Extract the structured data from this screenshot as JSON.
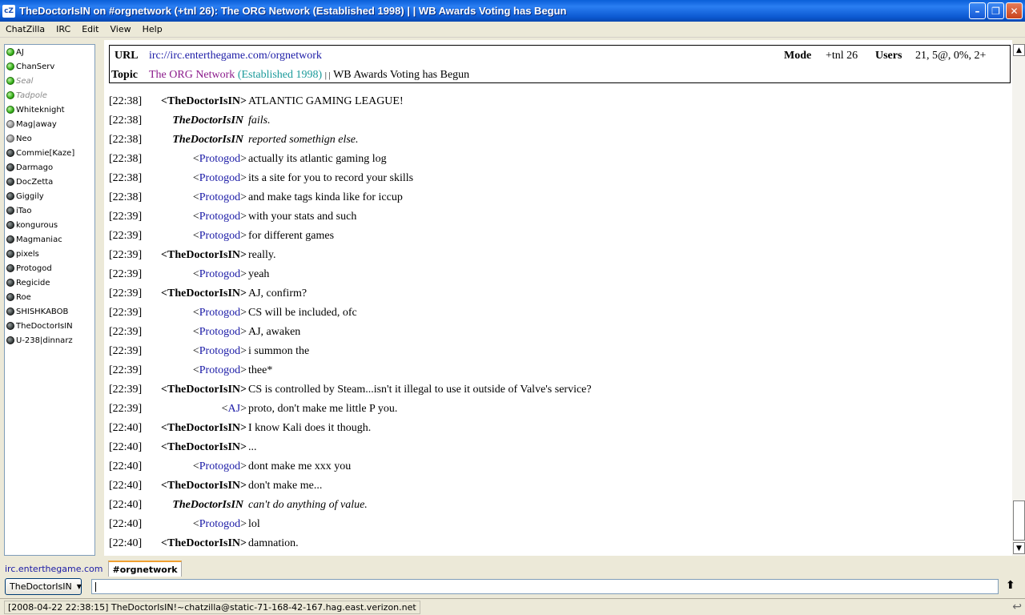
{
  "window": {
    "title": "TheDoctorIsIN on #orgnetwork (+tnl 26): The ORG Network (Established 1998) | | WB Awards Voting has Begun",
    "icon_label": "cZ",
    "minimize_label": "–",
    "maximize_label": "❐",
    "close_label": "✕"
  },
  "menu": [
    "ChatZilla",
    "IRC",
    "Edit",
    "View",
    "Help"
  ],
  "users": [
    {
      "name": "AJ",
      "status": "op"
    },
    {
      "name": "ChanServ",
      "status": "op"
    },
    {
      "name": "Seal",
      "status": "op",
      "dim": true
    },
    {
      "name": "Tadpole",
      "status": "op",
      "dim": true
    },
    {
      "name": "Whiteknight",
      "status": "op"
    },
    {
      "name": "Mag|away",
      "status": "away"
    },
    {
      "name": "Neo",
      "status": "away"
    },
    {
      "name": "Commie[Kaze]",
      "status": "normal"
    },
    {
      "name": "Darmago",
      "status": "normal"
    },
    {
      "name": "DocZetta",
      "status": "normal"
    },
    {
      "name": "Giggily",
      "status": "normal"
    },
    {
      "name": "iTao",
      "status": "normal"
    },
    {
      "name": "kongurous",
      "status": "normal"
    },
    {
      "name": "Magmaniac",
      "status": "normal"
    },
    {
      "name": "pixels",
      "status": "normal"
    },
    {
      "name": "Protogod",
      "status": "normal"
    },
    {
      "name": "Regicide",
      "status": "normal"
    },
    {
      "name": "Roe",
      "status": "normal"
    },
    {
      "name": "SHISHKABOB",
      "status": "normal"
    },
    {
      "name": "TheDoctorIsIN",
      "status": "normal"
    },
    {
      "name": "U-238|dinnarz",
      "status": "normal"
    }
  ],
  "header": {
    "url_label": "URL",
    "url": "irc://irc.enterthegame.com/orgnetwork",
    "mode_label": "Mode",
    "mode": "+tnl 26",
    "users_label": "Users",
    "users": "21, 5@, 0%, 2+",
    "topic_label": "Topic",
    "topic_part1": "The ORG Network",
    "topic_part2": "(Established 1998)",
    "topic_sep": "| |",
    "topic_part3": "WB Awards Voting has Begun",
    "topic_color1": "#8b1a8b",
    "topic_color2": "#1a9a9a"
  },
  "messages": [
    {
      "time": "[22:38]",
      "type": "msg",
      "nick": "TheDoctorIsIN",
      "self": true,
      "text": "ATLANTIC GAMING LEAGUE!"
    },
    {
      "time": "[22:38]",
      "type": "action",
      "nick": "TheDoctorIsIN",
      "text": "fails."
    },
    {
      "time": "[22:38]",
      "type": "action",
      "nick": "TheDoctorIsIN",
      "text": "reported somethign else."
    },
    {
      "time": "[22:38]",
      "type": "msg",
      "nick": "Protogod",
      "self": false,
      "text": "actually its atlantic gaming log"
    },
    {
      "time": "[22:38]",
      "type": "msg",
      "nick": "Protogod",
      "self": false,
      "text": "its a site for you to record your skills"
    },
    {
      "time": "[22:38]",
      "type": "msg",
      "nick": "Protogod",
      "self": false,
      "text": "and make tags kinda like for iccup"
    },
    {
      "time": "[22:39]",
      "type": "msg",
      "nick": "Protogod",
      "self": false,
      "text": "with your stats and such"
    },
    {
      "time": "[22:39]",
      "type": "msg",
      "nick": "Protogod",
      "self": false,
      "text": "for different games"
    },
    {
      "time": "[22:39]",
      "type": "msg",
      "nick": "TheDoctorIsIN",
      "self": true,
      "text": "really."
    },
    {
      "time": "[22:39]",
      "type": "msg",
      "nick": "Protogod",
      "self": false,
      "text": "yeah"
    },
    {
      "time": "[22:39]",
      "type": "msg",
      "nick": "TheDoctorIsIN",
      "self": true,
      "text": "AJ, confirm?"
    },
    {
      "time": "[22:39]",
      "type": "msg",
      "nick": "Protogod",
      "self": false,
      "text": "CS will be included, ofc"
    },
    {
      "time": "[22:39]",
      "type": "msg",
      "nick": "Protogod",
      "self": false,
      "text": "AJ, awaken"
    },
    {
      "time": "[22:39]",
      "type": "msg",
      "nick": "Protogod",
      "self": false,
      "text": "i summon the"
    },
    {
      "time": "[22:39]",
      "type": "msg",
      "nick": "Protogod",
      "self": false,
      "text": "thee*"
    },
    {
      "time": "[22:39]",
      "type": "msg",
      "nick": "TheDoctorIsIN",
      "self": true,
      "text": "CS is controlled by Steam...isn't it illegal to use it outside of Valve's service?"
    },
    {
      "time": "[22:39]",
      "type": "msg",
      "nick": "AJ",
      "self": false,
      "text": "proto, don't make me little P you."
    },
    {
      "time": "[22:40]",
      "type": "msg",
      "nick": "TheDoctorIsIN",
      "self": true,
      "text": "I know Kali does it though."
    },
    {
      "time": "[22:40]",
      "type": "msg",
      "nick": "TheDoctorIsIN",
      "self": true,
      "text": "..."
    },
    {
      "time": "[22:40]",
      "type": "msg",
      "nick": "Protogod",
      "self": false,
      "text": "dont make me xxx you"
    },
    {
      "time": "[22:40]",
      "type": "msg",
      "nick": "TheDoctorIsIN",
      "self": true,
      "text": "don't make me..."
    },
    {
      "time": "[22:40]",
      "type": "action",
      "nick": "TheDoctorIsIN",
      "text": "can't do anything of value."
    },
    {
      "time": "[22:40]",
      "type": "msg",
      "nick": "Protogod",
      "self": false,
      "text": "lol"
    },
    {
      "time": "[22:40]",
      "type": "msg",
      "nick": "TheDoctorIsIN",
      "self": true,
      "text": "damnation."
    }
  ],
  "tabs": [
    {
      "label": "irc.enterthegame.com",
      "active": false
    },
    {
      "label": "#orgnetwork",
      "active": true
    }
  ],
  "input": {
    "nick_button": "TheDoctorIsIN",
    "value": ""
  },
  "status": {
    "text": "[2008-04-22 22:38:15] TheDoctorIsIN!~chatzilla@static-71-168-42-167.hag.east.verizon.net"
  }
}
